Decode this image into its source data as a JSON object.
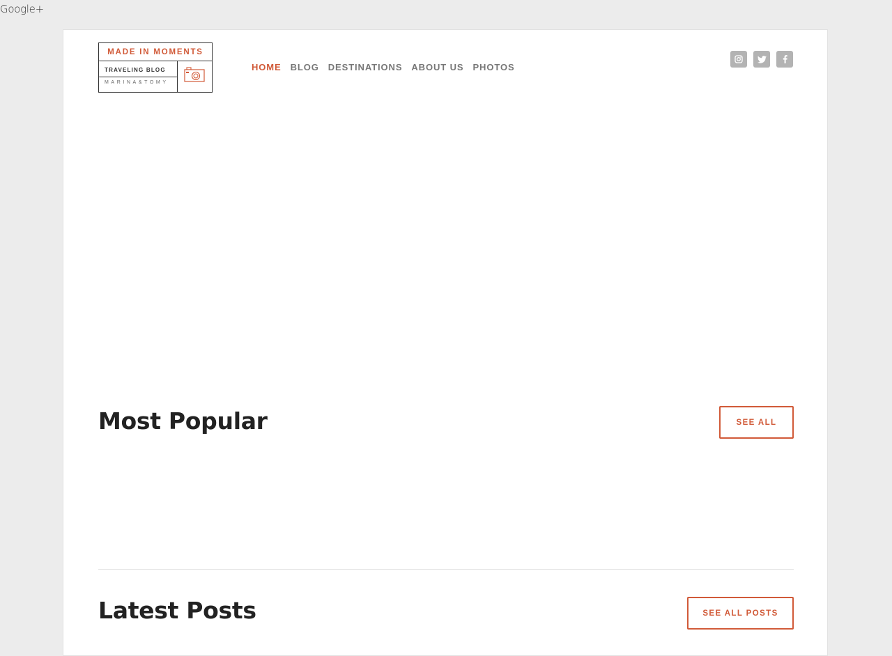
{
  "top_link": "Google+",
  "logo": {
    "title": "MADE IN MOMENTS",
    "subtitle": "TRAVELING BLOG",
    "authors": "MARINA&TOMY",
    "accent": "#d15a38"
  },
  "nav": {
    "items": [
      {
        "label": "HOME",
        "active": true
      },
      {
        "label": "BLOG"
      },
      {
        "label": "DESTINATIONS"
      },
      {
        "label": "ABOUT US"
      },
      {
        "label": "PHOTOS"
      }
    ]
  },
  "social": {
    "icons": [
      "instagram-icon",
      "twitter-icon",
      "facebook-icon"
    ],
    "color": "#b3b3b3"
  },
  "most_popular": {
    "title": "Most Popular",
    "button": "SEE ALL"
  },
  "latest_posts": {
    "title": "Latest Posts",
    "button": "SEE ALL POSTS"
  }
}
